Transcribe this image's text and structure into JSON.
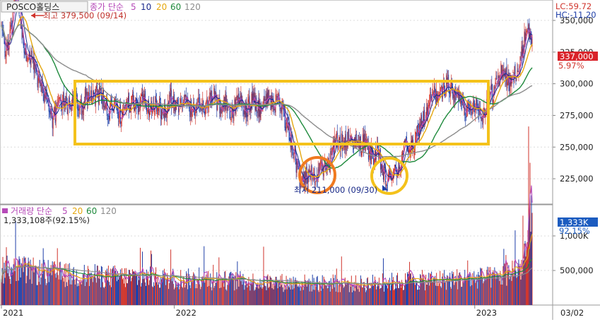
{
  "stock_name": "POSCO홀딩스",
  "price_legend": {
    "label": "종가 단순",
    "periods": [
      "5",
      "10",
      "20",
      "60",
      "120"
    ]
  },
  "volume_legend": {
    "label": "거래량 단순",
    "periods": [
      "5",
      "20",
      "60",
      "120"
    ]
  },
  "indicator_lc": "LC:59.72",
  "indicator_hc": "HC:-11.20",
  "high_annotation": "최고 379,500 (09/14)",
  "low_annotation": "최저 211,000 (09/30)",
  "current_price": "337,000",
  "current_change": "5.97%",
  "volume_info": "1,333,108주(92.15%)",
  "current_volume": "1,333K",
  "current_volume_pct": "92.15%",
  "colors": {
    "up": "#d0342c",
    "down": "#1f3fa8",
    "ma5": "#b64ab8",
    "ma10": "#1c2a8c",
    "ma20": "#e5a810",
    "ma60": "#1e8a3c",
    "ma120": "#8c8c8c",
    "box": "#f4c21b",
    "circle1": "#f07a20",
    "circle2": "#f4c21b",
    "price_tag": "#d9232a",
    "volume_tag": "#1c5cc0"
  },
  "chart_data": [
    {
      "type": "candlestick",
      "title": "POSCO홀딩스",
      "y_axis": {
        "ticks": [
          "225,000",
          "250,000",
          "275,000",
          "300,000",
          "325,000",
          "350,000"
        ],
        "ylim": [
          205000,
          365000
        ]
      },
      "x_axis": {
        "ticks": [
          "2021",
          "2022",
          "2023"
        ],
        "end_label": "03/02"
      },
      "series_shape": [
        [
          0,
          345000
        ],
        [
          5,
          320000
        ],
        [
          11,
          336000
        ],
        [
          15,
          352000
        ],
        [
          20,
          370000
        ],
        [
          26,
          352000
        ],
        [
          32,
          332000
        ],
        [
          40,
          318000
        ],
        [
          55,
          300000
        ],
        [
          62,
          288000
        ],
        [
          72,
          276000
        ],
        [
          82,
          282000
        ],
        [
          95,
          287000
        ],
        [
          110,
          283000
        ],
        [
          120,
          288000
        ],
        [
          130,
          296000
        ],
        [
          140,
          288000
        ],
        [
          150,
          282000
        ],
        [
          165,
          276000
        ],
        [
          180,
          283000
        ],
        [
          195,
          287000
        ],
        [
          210,
          283000
        ],
        [
          225,
          280000
        ],
        [
          240,
          286000
        ],
        [
          255,
          283000
        ],
        [
          270,
          280000
        ],
        [
          285,
          285000
        ],
        [
          300,
          288000
        ],
        [
          315,
          283000
        ],
        [
          325,
          280000
        ],
        [
          335,
          286000
        ],
        [
          345,
          284000
        ],
        [
          360,
          282000
        ],
        [
          375,
          286000
        ],
        [
          385,
          287000
        ],
        [
          395,
          282000
        ],
        [
          405,
          265000
        ],
        [
          413,
          240000
        ],
        [
          420,
          228000
        ],
        [
          430,
          225000
        ],
        [
          440,
          226000
        ],
        [
          450,
          230000
        ],
        [
          460,
          238000
        ],
        [
          472,
          252000
        ],
        [
          482,
          258000
        ],
        [
          495,
          255000
        ],
        [
          510,
          252000
        ],
        [
          522,
          246000
        ],
        [
          532,
          240000
        ],
        [
          540,
          230000
        ],
        [
          546,
          222000
        ],
        [
          552,
          226000
        ],
        [
          560,
          236000
        ],
        [
          572,
          250000
        ],
        [
          585,
          255000
        ],
        [
          595,
          272000
        ],
        [
          605,
          285000
        ],
        [
          615,
          292000
        ],
        [
          630,
          298000
        ],
        [
          640,
          292000
        ],
        [
          650,
          286000
        ],
        [
          660,
          280000
        ],
        [
          670,
          283000
        ],
        [
          680,
          277000
        ],
        [
          690,
          290000
        ],
        [
          700,
          305000
        ],
        [
          710,
          308000
        ],
        [
          720,
          302000
        ],
        [
          730,
          310000
        ],
        [
          737,
          335000
        ],
        [
          742,
          345000
        ],
        [
          747,
          330000
        ],
        [
          749,
          337000
        ]
      ],
      "moving_averages": [
        {
          "name": "5",
          "color": "#b64ab8"
        },
        {
          "name": "10",
          "color": "#1c2a8c"
        },
        {
          "name": "20",
          "color": "#e5a810"
        },
        {
          "name": "60",
          "color": "#1e8a3c"
        },
        {
          "name": "120",
          "color": "#8c8c8c"
        }
      ],
      "annotations": [
        "최고 379,500 (09/14)",
        "최저 211,000 (09/30)"
      ]
    },
    {
      "type": "bar",
      "title": "거래량",
      "y_axis": {
        "ticks": [
          "500,000",
          "1,000K"
        ],
        "ylim": [
          0,
          1450000
        ]
      },
      "x_axis": {
        "ticks": [
          "2021",
          "2022",
          "2023"
        ]
      },
      "level_shape": [
        [
          0,
          560000
        ],
        [
          100,
          450000
        ],
        [
          200,
          420000
        ],
        [
          300,
          380000
        ],
        [
          400,
          340000
        ],
        [
          500,
          320000
        ],
        [
          600,
          380000
        ],
        [
          700,
          420000
        ],
        [
          735,
          600000
        ],
        [
          749,
          1333108
        ]
      ],
      "moving_averages": [
        {
          "name": "5",
          "color": "#b64ab8"
        },
        {
          "name": "20",
          "color": "#e5a810"
        },
        {
          "name": "60",
          "color": "#1e8a3c"
        },
        {
          "name": "120",
          "color": "#8c8c8c"
        }
      ]
    }
  ]
}
